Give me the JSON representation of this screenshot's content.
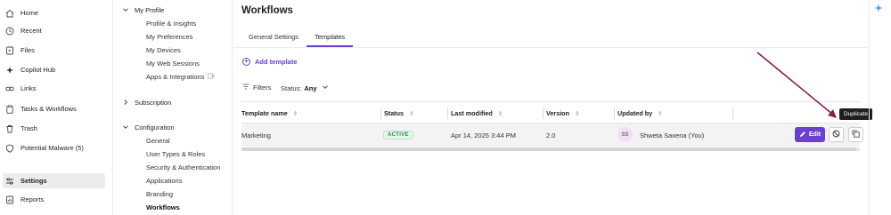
{
  "left_nav": {
    "items": [
      {
        "label": "Home",
        "icon": "home-icon"
      },
      {
        "label": "Recent",
        "icon": "clock-icon"
      },
      {
        "label": "Files",
        "icon": "file-icon"
      },
      {
        "label": "Copilot Hub",
        "icon": "sparkle-icon"
      },
      {
        "label": "Links",
        "icon": "link-icon"
      },
      {
        "label": "Tasks & Workflows",
        "icon": "clipboard-icon"
      },
      {
        "label": "Trash",
        "icon": "trash-icon"
      },
      {
        "label": "Potential Malware (5)",
        "icon": "shield-icon"
      },
      {
        "label": "Settings",
        "icon": "sliders-icon",
        "active": true
      },
      {
        "label": "Reports",
        "icon": "report-icon"
      }
    ]
  },
  "settings_nav": {
    "my_profile": {
      "label": "My Profile",
      "items": [
        "Profile & Insights",
        "My Preferences",
        "My Devices",
        "My Web Sessions",
        "Apps & Integrations"
      ]
    },
    "subscription": {
      "label": "Subscription"
    },
    "configuration": {
      "label": "Configuration",
      "items": [
        "General",
        "User Types & Roles",
        "Security & Authentication",
        "Applications",
        "Branding",
        "Workflows"
      ]
    }
  },
  "main": {
    "title": "Workflows",
    "tabs": [
      {
        "label": "General Settings"
      },
      {
        "label": "Templates",
        "active": true
      }
    ],
    "add_template": "Add template",
    "filters_label": "Filters",
    "status_label": "Status:",
    "status_value": "Any"
  },
  "table": {
    "columns": [
      "Template name",
      "Status",
      "Last modified",
      "Version",
      "Updated by"
    ],
    "rows": [
      {
        "name": "Marketing",
        "status": "ACTIVE",
        "last_modified": "Apr 14, 2025 3:44 PM",
        "version": "2.0",
        "avatar_initials": "SS",
        "updated_by": "Shweta Saxena (You)"
      }
    ],
    "edit_label": "Edit",
    "tooltip": "Duplicate"
  },
  "colors": {
    "accent": "#6b3fcf",
    "active_badge": "#2e8b57",
    "annotation_arrow": "#8b1e4f"
  }
}
